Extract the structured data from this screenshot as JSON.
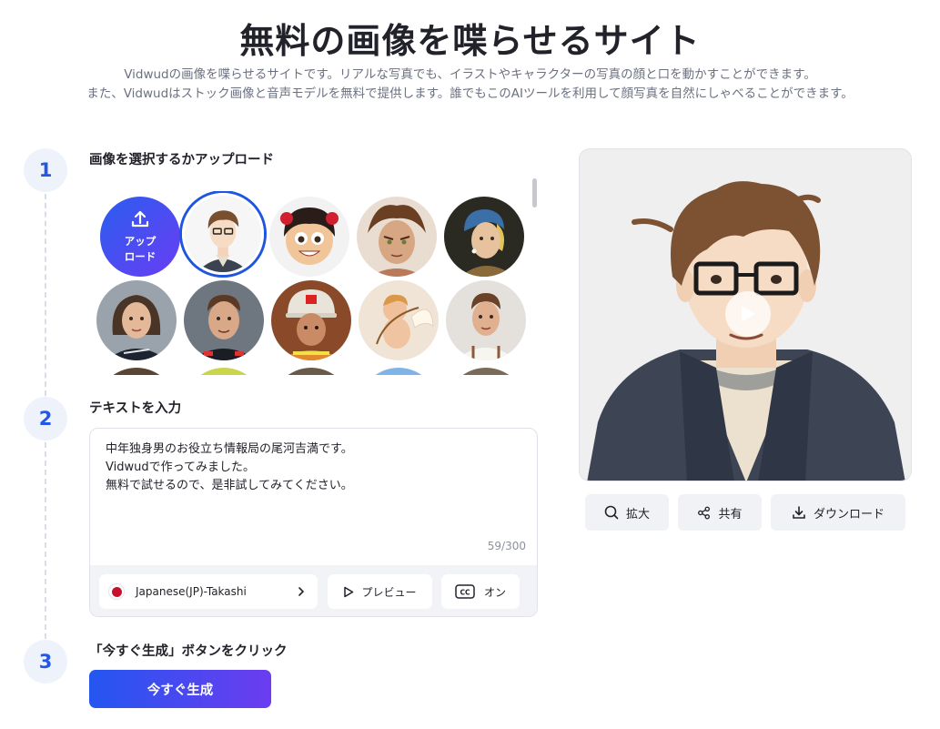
{
  "page": {
    "title": "無料の画像を喋らせるサイト",
    "subtitle_line1": "Vidwudの画像を喋らせるサイトです。リアルな写真でも、イラストやキャラクターの写真の顔と口を動かすことができます。",
    "subtitle_line2": "また、Vidwudはストック画像と音声モデルを無料で提供します。誰でもこのAIツールを利用して顔写真を自然にしゃべることができます。"
  },
  "steps": [
    {
      "number": "1",
      "label": "画像を選択するかアップロード"
    },
    {
      "number": "2",
      "label": "テキストを入力"
    },
    {
      "number": "3",
      "label": "「今すぐ生成」ボタンをクリック"
    }
  ],
  "upload": {
    "line1": "アップ",
    "line2": "ロード",
    "icon": "upload-icon"
  },
  "avatars": {
    "selected_index": 0,
    "items": [
      "anime-man-glasses",
      "cartoon-girl",
      "fierce-warrior",
      "pearl-earring-girl",
      "racing-woman",
      "racing-man",
      "firefighter",
      "cupid",
      "chef-man"
    ]
  },
  "text_input": {
    "line1": "中年独身男のお役立ち情報局の尾河吉満です。",
    "line2": "Vidwudで作ってみました。",
    "line3": "無料で試せるので、是非試してみてください。",
    "counter": "59/300"
  },
  "voice": {
    "label": "Japanese(JP)-Takashi",
    "flag": "japan-flag"
  },
  "preview_button": {
    "label": "プレビュー"
  },
  "caption_toggle": {
    "label": "オン"
  },
  "generate_button": {
    "label": "今すぐ生成"
  },
  "actions": {
    "zoom": "拡大",
    "share": "共有",
    "download": "ダウンロード"
  },
  "colors": {
    "accent": "#2457e6",
    "gradient_start": "#2456f0",
    "gradient_end": "#6c3cf0"
  }
}
